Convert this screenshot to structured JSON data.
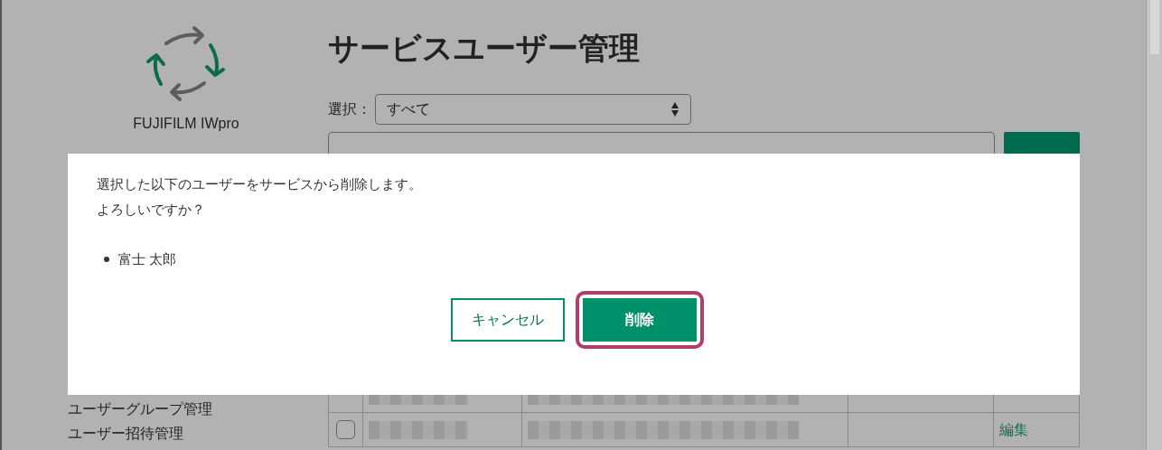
{
  "sidebar": {
    "logo_text": "FUJIFILM IWpro",
    "items": [
      {
        "label": "ユーザーグループ管理"
      },
      {
        "label": "ユーザー招待管理"
      }
    ]
  },
  "page": {
    "title": "サービスユーザー管理",
    "filter": {
      "label": "選択：",
      "value": "すべて"
    },
    "table": {
      "rows": [
        {},
        {
          "checked": false,
          "edit": "編集"
        }
      ]
    }
  },
  "dialog": {
    "message_lines": [
      "選択した以下のユーザーをサービスから削除します。",
      "よろしいですか？"
    ],
    "items": [
      "富士 太郎"
    ],
    "buttons": [
      {
        "label": "キャンセル",
        "kind": "secondary",
        "focused": false
      },
      {
        "label": "削除",
        "kind": "primary",
        "focused": true
      }
    ]
  }
}
